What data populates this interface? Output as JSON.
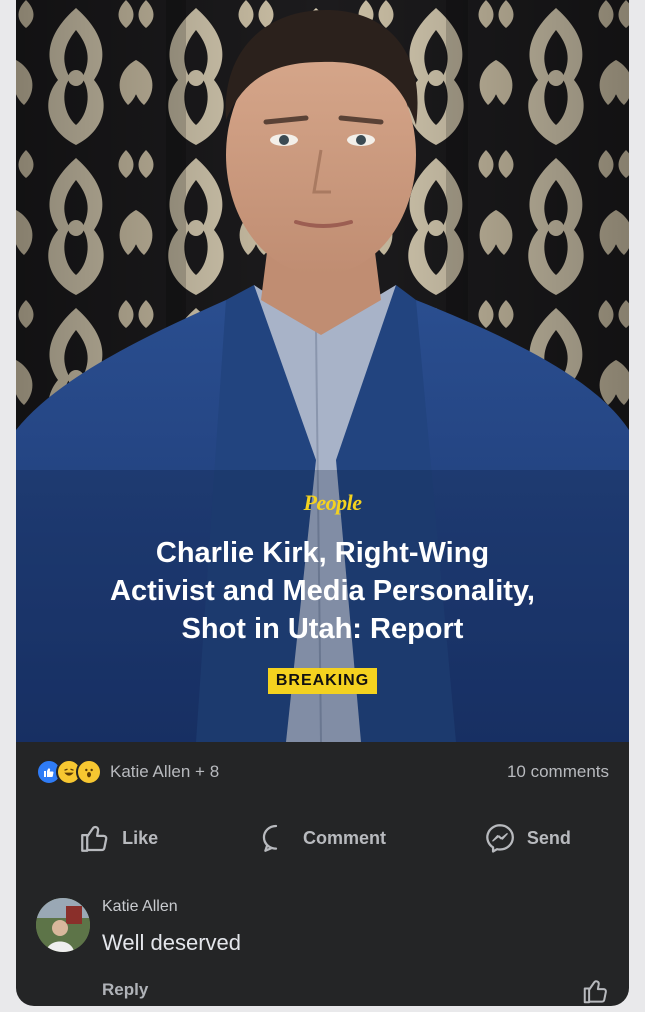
{
  "post": {
    "brand": "People",
    "headline_lines": [
      "Charlie Kirk, Right-Wing",
      "Activist and Media Personality,",
      "Shot in Utah: Report"
    ],
    "badge": "BREAKING"
  },
  "stats": {
    "reaction_icons": [
      "like-reaction",
      "haha-reaction",
      "wow-reaction"
    ],
    "reactors": "Katie Allen + 8",
    "comments_count": "10 comments"
  },
  "actions": {
    "like": "Like",
    "comment": "Comment",
    "send": "Send"
  },
  "comment": {
    "author": "Katie Allen",
    "text": "Well deserved",
    "reply_label": "Reply"
  },
  "colors": {
    "card_bg": "#242526",
    "accent_yellow": "#f4d21f",
    "like_blue": "#2f7cf6",
    "text_muted": "#b8babe"
  }
}
